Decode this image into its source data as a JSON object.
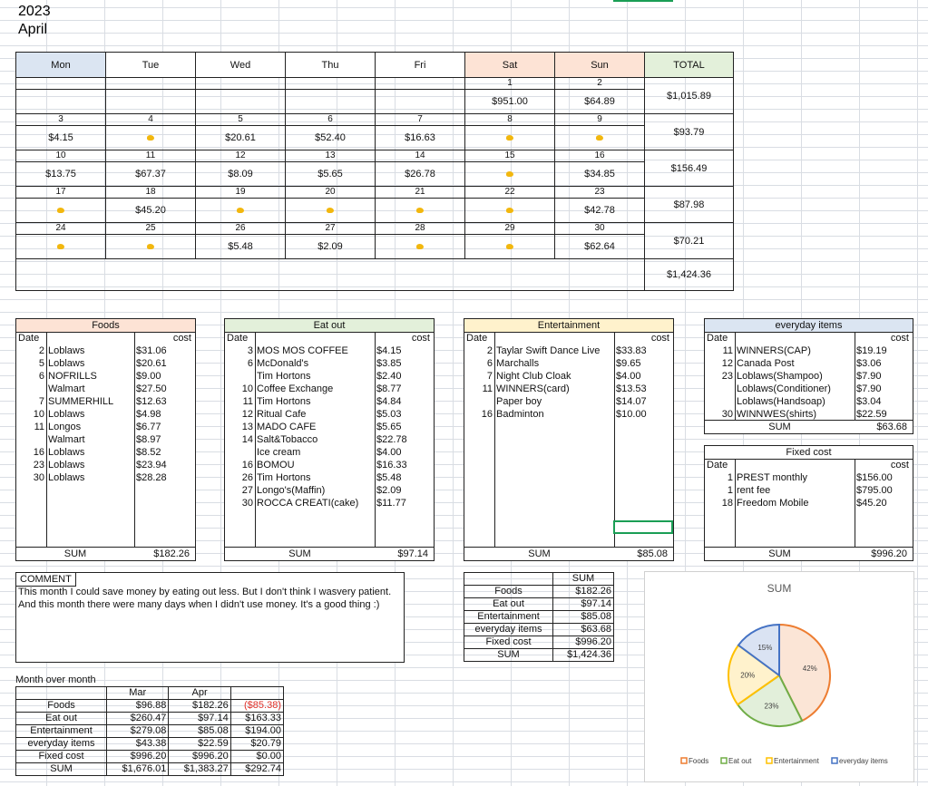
{
  "header": {
    "year": "2023",
    "month": "April"
  },
  "calendar": {
    "days": [
      "Mon",
      "Tue",
      "Wed",
      "Thu",
      "Fri",
      "Sat",
      "Sun",
      "TOTAL"
    ],
    "day_colors": [
      "#dbe5f2",
      "#ffffff",
      "#ffffff",
      "#ffffff",
      "#ffffff",
      "#fde3d5",
      "#fde3d5",
      "#e3f0da"
    ],
    "weeks": [
      {
        "nums": [
          "",
          "",
          "",
          "",
          "",
          "1",
          "2"
        ],
        "vals": [
          "",
          "",
          "",
          "",
          "",
          "$951.00",
          "$64.89"
        ],
        "total": "$1,015.89"
      },
      {
        "nums": [
          "3",
          "4",
          "5",
          "6",
          "7",
          "8",
          "9"
        ],
        "vals": [
          "$4.15",
          "dot",
          "$20.61",
          "$52.40",
          "$16.63",
          "dot",
          "dot"
        ],
        "total": "$93.79"
      },
      {
        "nums": [
          "10",
          "11",
          "12",
          "13",
          "14",
          "15",
          "16"
        ],
        "vals": [
          "$13.75",
          "$67.37",
          "$8.09",
          "$5.65",
          "$26.78",
          "dot",
          "$34.85"
        ],
        "total": "$156.49"
      },
      {
        "nums": [
          "17",
          "18",
          "19",
          "20",
          "21",
          "22",
          "23"
        ],
        "vals": [
          "dot",
          "$45.20",
          "dot",
          "dot",
          "dot",
          "dot",
          "$42.78"
        ],
        "total": "$87.98"
      },
      {
        "nums": [
          "24",
          "25",
          "26",
          "27",
          "28",
          "29",
          "30"
        ],
        "vals": [
          "dot",
          "dot",
          "$5.48",
          "$2.09",
          "dot",
          "dot",
          "$62.64"
        ],
        "total": "$70.21"
      }
    ],
    "grand_total": "$1,424.36"
  },
  "foods": {
    "title": "Foods",
    "date_label": "Date",
    "cost_label": "cost",
    "color": "#fde3d5",
    "rows": [
      {
        "d": "2",
        "n": "Loblaws",
        "c": "$31.06"
      },
      {
        "d": "5",
        "n": "Loblaws",
        "c": "$20.61"
      },
      {
        "d": "6",
        "n": "NOFRILLS",
        "c": "$9.00"
      },
      {
        "d": "",
        "n": "Walmart",
        "c": "$27.50"
      },
      {
        "d": "7",
        "n": "SUMMERHILL",
        "c": "$12.63"
      },
      {
        "d": "10",
        "n": "Loblaws",
        "c": "$4.98"
      },
      {
        "d": "11",
        "n": "Longos",
        "c": "$6.77"
      },
      {
        "d": "",
        "n": "Walmart",
        "c": "$8.97"
      },
      {
        "d": "16",
        "n": "Loblaws",
        "c": "$8.52"
      },
      {
        "d": "23",
        "n": "Loblaws",
        "c": "$23.94"
      },
      {
        "d": "30",
        "n": "Loblaws",
        "c": "$28.28"
      }
    ],
    "sum_label": "SUM",
    "sum": "$182.26"
  },
  "eatout": {
    "title": "Eat out",
    "date_label": "Date",
    "cost_label": "cost",
    "color": "#e3f0da",
    "rows": [
      {
        "d": "3",
        "n": "MOS MOS COFFEE",
        "c": "$4.15"
      },
      {
        "d": "6",
        "n": "McDonald's",
        "c": "$3.85"
      },
      {
        "d": "",
        "n": "Tim Hortons",
        "c": "$2.40"
      },
      {
        "d": "10",
        "n": "Coffee Exchange",
        "c": "$8.77"
      },
      {
        "d": "11",
        "n": "Tim Hortons",
        "c": "$4.84"
      },
      {
        "d": "12",
        "n": "Ritual Cafe",
        "c": "$5.03"
      },
      {
        "d": "13",
        "n": "MADO CAFE",
        "c": "$5.65"
      },
      {
        "d": "14",
        "n": "Salt&Tobacco",
        "c": "$22.78"
      },
      {
        "d": "",
        "n": "Ice cream",
        "c": "$4.00"
      },
      {
        "d": "16",
        "n": "BOMOU",
        "c": "$16.33"
      },
      {
        "d": "26",
        "n": "Tim Hortons",
        "c": "$5.48"
      },
      {
        "d": "27",
        "n": "Longo's(Maffin)",
        "c": "$2.09"
      },
      {
        "d": "30",
        "n": "ROCCA CREATI(cake)",
        "c": "$11.77"
      }
    ],
    "sum_label": "SUM",
    "sum": "$97.14"
  },
  "entertainment": {
    "title": "Entertainment",
    "date_label": "Date",
    "cost_label": "cost",
    "color": "#fff2cc",
    "rows": [
      {
        "d": "2",
        "n": "Taylar Swift Dance Live",
        "c": "$33.83"
      },
      {
        "d": "6",
        "n": "Marchalls",
        "c": "$9.65"
      },
      {
        "d": "7",
        "n": "Night Club Cloak",
        "c": "$4.00"
      },
      {
        "d": "11",
        "n": "WINNERS(card)",
        "c": "$13.53"
      },
      {
        "d": "",
        "n": "Paper boy",
        "c": "$14.07"
      },
      {
        "d": "16",
        "n": "Badminton",
        "c": "$10.00"
      }
    ],
    "sum_label": "SUM",
    "sum": "$85.08"
  },
  "everyday": {
    "title": "everyday items",
    "date_label": "Date",
    "cost_label": "cost",
    "color": "#dbe5f2",
    "rows": [
      {
        "d": "11",
        "n": "WINNERS(CAP)",
        "c": "$19.19"
      },
      {
        "d": "12",
        "n": "Canada Post",
        "c": "$3.06"
      },
      {
        "d": "23",
        "n": "Loblaws(Shampoo)",
        "c": "$7.90"
      },
      {
        "d": "",
        "n": "Loblaws(Conditioner)",
        "c": "$7.90"
      },
      {
        "d": "",
        "n": "Loblaws(Handsoap)",
        "c": "$3.04"
      },
      {
        "d": "30",
        "n": "WINNWES(shirts)",
        "c": "$22.59"
      }
    ],
    "sum_label": "SUM",
    "sum": "$63.68"
  },
  "fixed": {
    "title": "Fixed cost",
    "date_label": "Date",
    "cost_label": "cost",
    "rows": [
      {
        "d": "1",
        "n": "PREST monthly",
        "c": "$156.00"
      },
      {
        "d": "1",
        "n": "rent fee",
        "c": "$795.00"
      },
      {
        "d": "18",
        "n": "Freedom Mobile",
        "c": "$45.20"
      }
    ],
    "sum_label": "SUM",
    "sum": "$996.20"
  },
  "comment": {
    "label": "COMMENT",
    "line1": "This month I could save money by eating out less. But I don't think I wasvery patient.",
    "line2": "And this month there were many days when I didn't use money. It's a good thing :)"
  },
  "summary": {
    "header": "SUM",
    "rows": [
      {
        "n": "Foods",
        "v": "$182.26"
      },
      {
        "n": "Eat out",
        "v": "$97.14"
      },
      {
        "n": "Entertainment",
        "v": "$85.08"
      },
      {
        "n": "everyday items",
        "v": "$63.68"
      },
      {
        "n": "Fixed cost",
        "v": "$996.20"
      },
      {
        "n": "SUM",
        "v": "$1,424.36"
      }
    ]
  },
  "mom": {
    "title": "Month over month",
    "cols": [
      "Mar",
      "Apr"
    ],
    "rows": [
      {
        "n": "Foods",
        "mar": "$96.88",
        "apr": "$182.26",
        "diff": "($85.38)",
        "neg": true
      },
      {
        "n": "Eat out",
        "mar": "$260.47",
        "apr": "$97.14",
        "diff": "$163.33",
        "neg": false
      },
      {
        "n": "Entertainment",
        "mar": "$279.08",
        "apr": "$85.08",
        "diff": "$194.00",
        "neg": false
      },
      {
        "n": "everyday items",
        "mar": "$43.38",
        "apr": "$22.59",
        "diff": "$20.79",
        "neg": false
      },
      {
        "n": "Fixed cost",
        "mar": "$996.20",
        "apr": "$996.20",
        "diff": "$0.00",
        "neg": false
      },
      {
        "n": "SUM",
        "mar": "$1,676.01",
        "apr": "$1,383.27",
        "diff": "$292.74",
        "neg": false
      }
    ]
  },
  "chart_data": {
    "type": "pie",
    "title": "SUM",
    "categories": [
      "Foods",
      "Eat out",
      "Entertainment",
      "everyday items"
    ],
    "values": [
      182.26,
      97.14,
      85.08,
      63.68
    ],
    "labels": [
      "42%",
      "23%",
      "20%",
      "15%"
    ],
    "colors": [
      "#ed7d31",
      "#70ad47",
      "#ffc000",
      "#4472c4"
    ],
    "fills": [
      "#fbe5d6",
      "#e2efda",
      "#fff2cc",
      "#dae3f3"
    ],
    "legend": "bottom"
  }
}
